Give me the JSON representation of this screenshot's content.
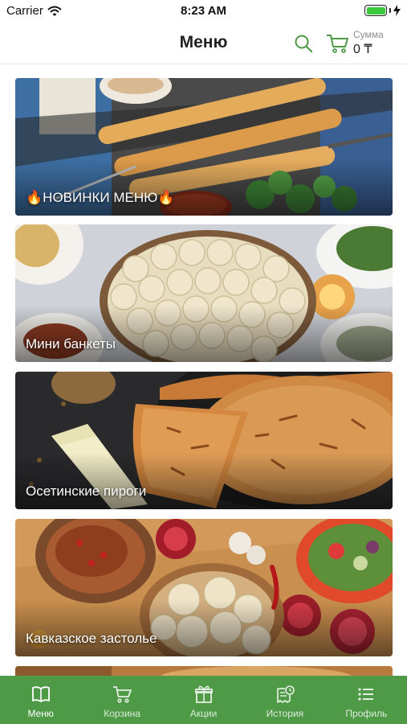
{
  "status_bar": {
    "carrier": "Carrier",
    "time": "8:23 AM",
    "battery_level": 1.0
  },
  "header": {
    "title": "Меню",
    "search_icon": "search-icon",
    "cart_icon": "cart-icon",
    "sum_label": "Сумма",
    "sum_value": "0 ₸"
  },
  "categories": [
    {
      "title": "🔥НОВИНКИ МЕНЮ🔥"
    },
    {
      "title": "Мини банкеты"
    },
    {
      "title": "Осетинские пироги"
    },
    {
      "title": "Кавказское застолье"
    }
  ],
  "tabs": [
    {
      "label": "Меню",
      "icon": "book-icon",
      "active": true
    },
    {
      "label": "Корзина",
      "icon": "cart-icon",
      "active": false
    },
    {
      "label": "Акции",
      "icon": "gift-icon",
      "active": false
    },
    {
      "label": "История",
      "icon": "history-icon",
      "active": false
    },
    {
      "label": "Профиль",
      "icon": "list-icon",
      "active": false
    }
  ],
  "colors": {
    "accent": "#4e9a47",
    "tab_bar": "#4e9a47",
    "battery": "#3cc93c"
  }
}
